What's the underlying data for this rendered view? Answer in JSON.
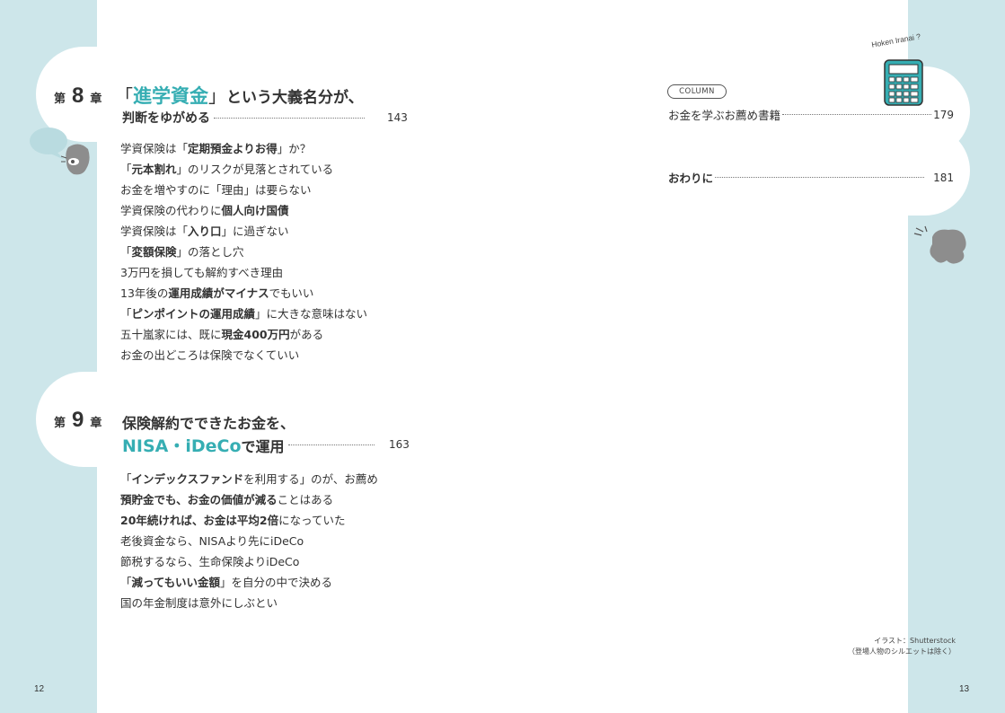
{
  "running_header": "Hoken Iranai ?",
  "chapter8": {
    "dai": "第",
    "number": "8",
    "sho": "章",
    "title_open_bracket": "「",
    "title_accent": "進学資金",
    "title_close_bracket": "」",
    "title_rest_line1": "という大義名分が、",
    "title_line2": "判断をゆがめる",
    "page": "143",
    "items": [
      {
        "pre": "学資保険は「",
        "bold": "定期預金よりお得",
        "post": "」か？"
      },
      {
        "pre": "「",
        "bold": "元本割れ",
        "post": "」のリスクが見落とされている"
      },
      {
        "pre": "お金を増やすのに「理由」は要らない",
        "bold": "",
        "post": ""
      },
      {
        "pre": "学資保険の代わりに",
        "bold": "個人向け国債",
        "post": ""
      },
      {
        "pre": "学資保険は「",
        "bold": "入り口",
        "post": "」に過ぎない"
      },
      {
        "pre": "「",
        "bold": "変額保険",
        "post": "」の落とし穴"
      },
      {
        "pre": "3万円を損しても解約すべき理由",
        "bold": "",
        "post": ""
      },
      {
        "pre": "13年後の",
        "bold": "運用成績がマイナス",
        "post": "でもいい"
      },
      {
        "pre": "「",
        "bold": "ピンポイントの運用成績",
        "post": "」に大きな意味はない"
      },
      {
        "pre": "五十嵐家には、既に",
        "bold": "現金400万円",
        "post": "がある"
      },
      {
        "pre": "お金の出どころは保険でなくていい",
        "bold": "",
        "post": ""
      }
    ]
  },
  "chapter9": {
    "dai": "第",
    "number": "9",
    "sho": "章",
    "title_line1": "保険解約でできたお金を、",
    "title_accent": "NISA・iDeCo",
    "title_line2_rest": "で運用",
    "page": "163",
    "items": [
      {
        "pre": "「",
        "bold": "インデックスファンド",
        "post": "を利用する」のが、お薦め"
      },
      {
        "pre": "",
        "bold": "預貯金でも、お金の価値が減る",
        "post": "ことはある"
      },
      {
        "pre": "",
        "bold": "20年続ければ、お金は平均2倍",
        "post": "になっていた"
      },
      {
        "pre": "老後資金なら、NISAより先にiDeCo",
        "bold": "",
        "post": ""
      },
      {
        "pre": "節税するなら、生命保険よりiDeCo",
        "bold": "",
        "post": ""
      },
      {
        "pre": "「",
        "bold": "減ってもいい金額",
        "post": "」を自分の中で決める"
      },
      {
        "pre": "国の年金制度は意外にしぶとい",
        "bold": "",
        "post": ""
      }
    ]
  },
  "column": {
    "badge": "COLUMN",
    "title": "お金を学ぶお薦め書籍",
    "page": "179"
  },
  "closing": {
    "title": "おわりに",
    "page": "181"
  },
  "credit": {
    "line1": "イラスト：Shutterstock",
    "line2": "（登場人物のシルエットは除く）"
  },
  "page_left": "12",
  "page_right": "13",
  "colors": {
    "accent": "#36aeb3",
    "band": "#cde6ea",
    "text": "#333333"
  }
}
